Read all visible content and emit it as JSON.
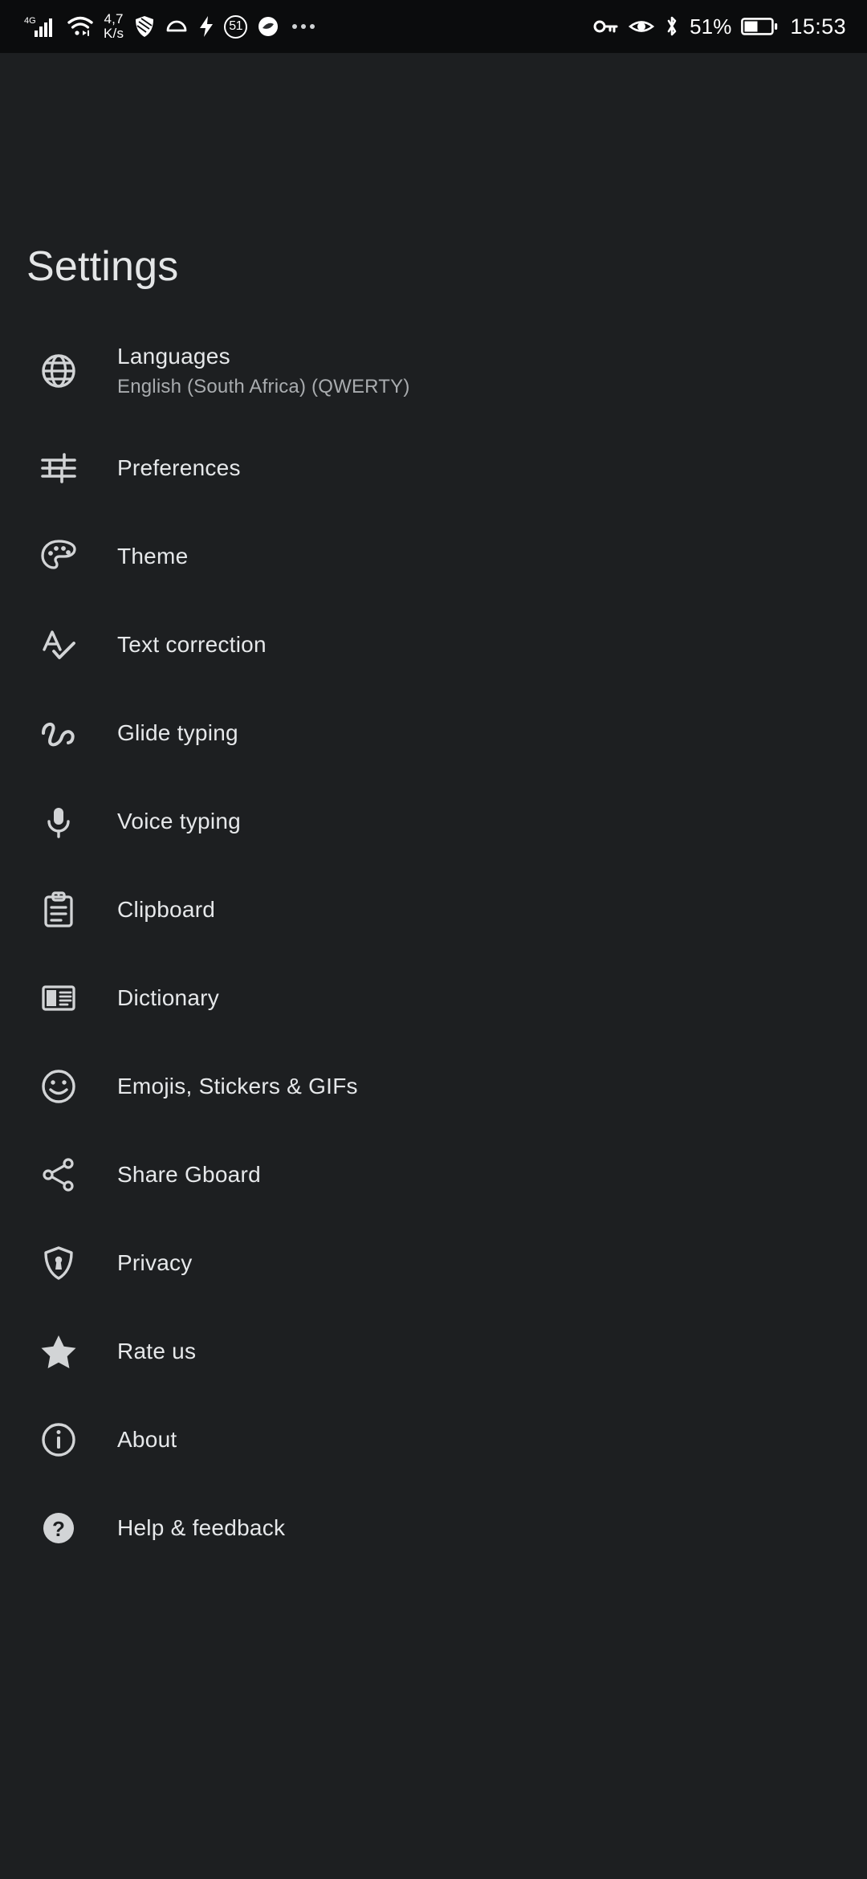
{
  "status_bar": {
    "network_type": "4G",
    "net_speed_value": "4,7",
    "net_speed_unit": "K/s",
    "counter_badge": "51",
    "battery_percent": "51%",
    "clock": "15:53",
    "left_icons": [
      "signal-bars-icon",
      "wifi-icon",
      "shield-icon",
      "dome-icon",
      "lightning-bolt-icon",
      "counter-circle-icon",
      "app-badge-icon",
      "overflow-dots-icon"
    ],
    "right_icons": [
      "vpn-key-icon",
      "eye-icon",
      "bluetooth-icon",
      "battery-icon"
    ]
  },
  "header": {
    "title": "Settings"
  },
  "settings": {
    "items": [
      {
        "icon": "globe-icon",
        "label": "Languages",
        "sub": "English (South Africa) (QWERTY)"
      },
      {
        "icon": "tune-icon",
        "label": "Preferences",
        "sub": ""
      },
      {
        "icon": "palette-icon",
        "label": "Theme",
        "sub": ""
      },
      {
        "icon": "spellcheck-icon",
        "label": "Text correction",
        "sub": ""
      },
      {
        "icon": "gesture-icon",
        "label": "Glide typing",
        "sub": ""
      },
      {
        "icon": "microphone-icon",
        "label": "Voice typing",
        "sub": ""
      },
      {
        "icon": "clipboard-icon",
        "label": "Clipboard",
        "sub": ""
      },
      {
        "icon": "book-icon",
        "label": "Dictionary",
        "sub": ""
      },
      {
        "icon": "emoji-icon",
        "label": "Emojis, Stickers & GIFs",
        "sub": ""
      },
      {
        "icon": "share-icon",
        "label": "Share Gboard",
        "sub": ""
      },
      {
        "icon": "privacy-icon",
        "label": "Privacy",
        "sub": ""
      },
      {
        "icon": "star-icon",
        "label": "Rate us",
        "sub": ""
      },
      {
        "icon": "info-icon",
        "label": "About",
        "sub": ""
      },
      {
        "icon": "help-icon",
        "label": "Help & feedback",
        "sub": ""
      }
    ]
  },
  "colors": {
    "background": "#1d1f21",
    "status_bar_background": "#0b0c0d",
    "primary_text": "#e6e8ea",
    "secondary_text": "#a9acaf",
    "icon": "#d2d4d6"
  }
}
